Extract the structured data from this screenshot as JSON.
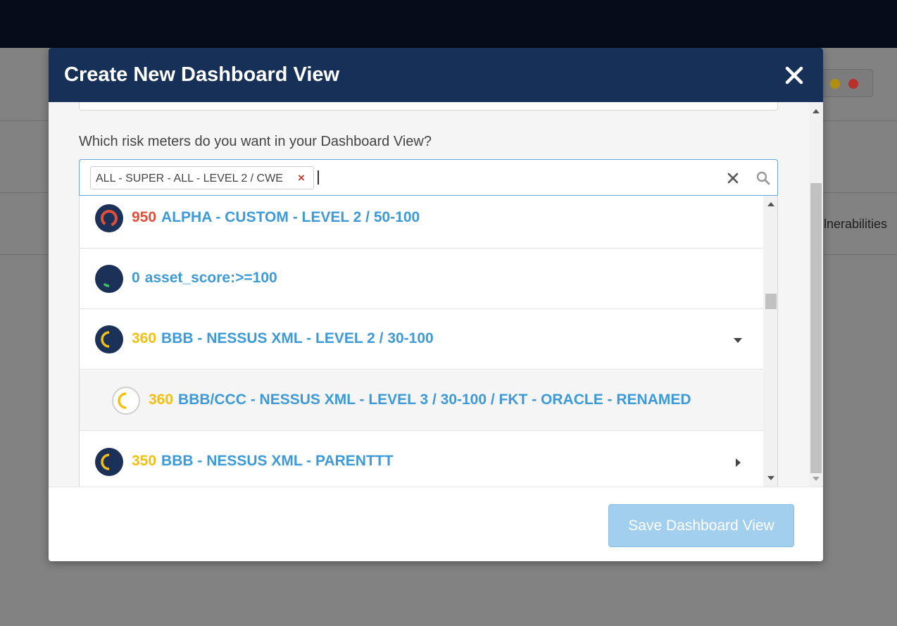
{
  "background": {
    "partial_text": "ulnerabilities",
    "indicator_colors": [
      "#b08f10",
      "#b7302a"
    ]
  },
  "modal": {
    "title": "Create New Dashboard View",
    "question": "Which risk meters do you want in your Dashboard View?",
    "select": {
      "tags": [
        {
          "label": "ALL - SUPER - ALL - LEVEL 2 / CWE",
          "remove": "×"
        }
      ]
    },
    "options": [
      {
        "score": "950",
        "score_color": "#e04f3a",
        "name": "ALPHA - CUSTOM - LEVEL 2 / 50-100",
        "meter": "red",
        "expand": "none"
      },
      {
        "score": "0",
        "score_color": "#3e9ad7",
        "name": "asset_score:>=100",
        "meter": "green",
        "expand": "none"
      },
      {
        "score": "360",
        "score_color": "#f2c014",
        "name": "BBB - NESSUS XML - LEVEL 2 / 30-100",
        "meter": "yellow",
        "expand": "expanded"
      },
      {
        "score": "360",
        "score_color": "#f2c014",
        "name": "BBB/CCC - NESSUS XML - LEVEL 3 / 30-100 / FKT - ORACLE - RENAMED",
        "meter": "yellow-light",
        "expand": "none",
        "child": true
      },
      {
        "score": "350",
        "score_color": "#f2c014",
        "name": "BBB - NESSUS XML - PARENTTT",
        "meter": "yellow",
        "expand": "collapsed"
      }
    ],
    "footer": {
      "save_label": "Save Dashboard View"
    }
  }
}
